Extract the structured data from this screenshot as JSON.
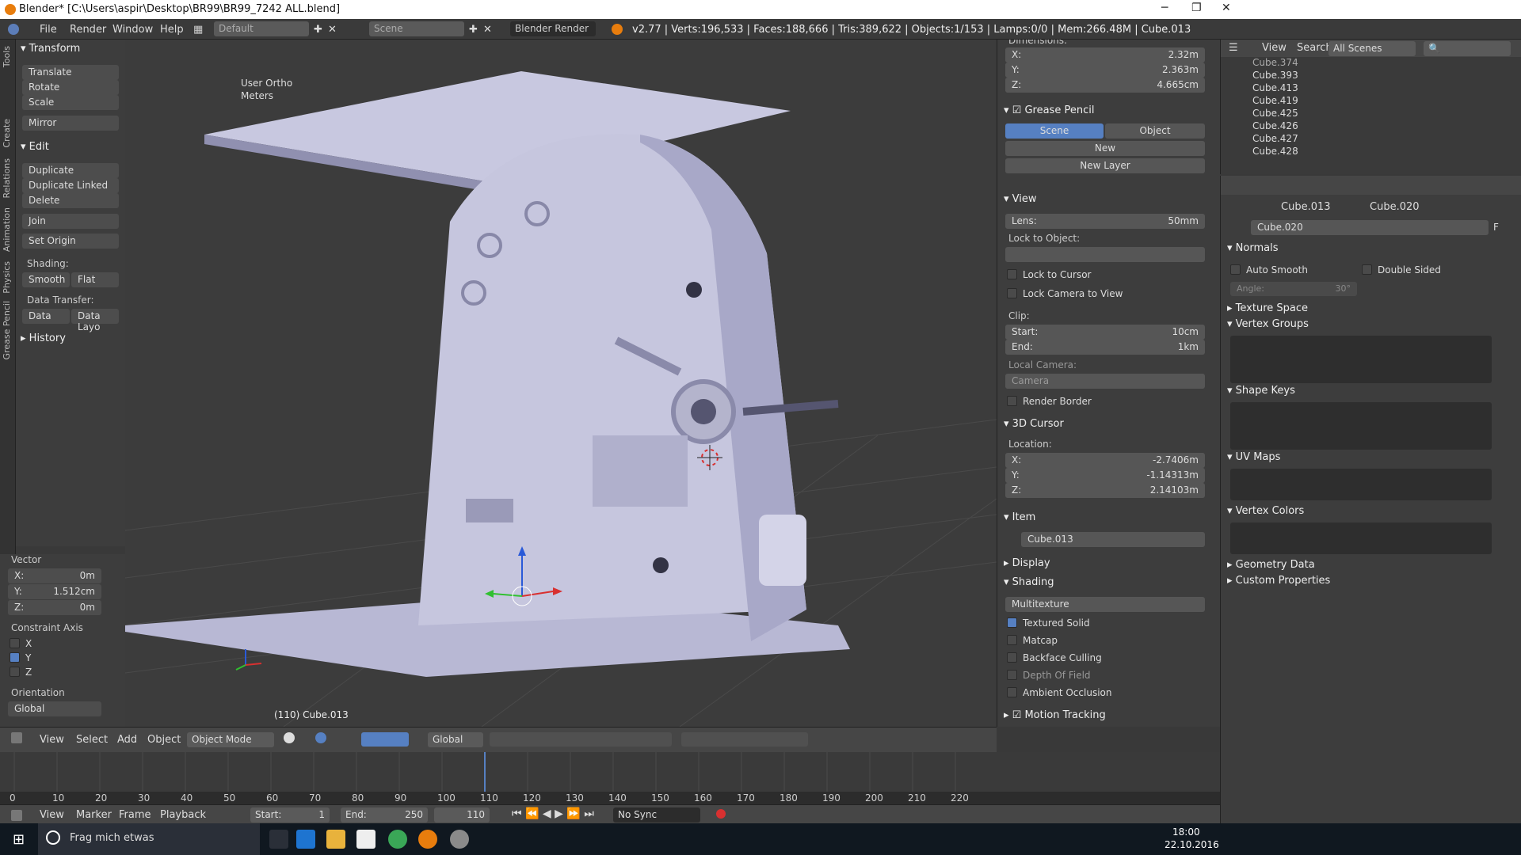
{
  "titlebar": {
    "title": "Blender* [C:\\Users\\aspir\\Desktop\\BR99\\BR99_7242 ALL.blend]",
    "minimize": "─",
    "maximize": "❐",
    "close": "✕"
  },
  "info": {
    "menus": [
      "File",
      "Render",
      "Window",
      "Help"
    ],
    "layout": "Default",
    "scene": "Scene",
    "engine": "Blender Render",
    "stats": "v2.77 | Verts:196,533 | Faces:188,666 | Tris:389,622 | Objects:1/153 | Lamps:0/0 | Mem:266.48M | Cube.013"
  },
  "lefttabs": [
    "Tools",
    "Create",
    "Relations",
    "Animation",
    "Physics",
    "Grease Pencil"
  ],
  "toolshelf": {
    "transform_header": "Transform",
    "transform": [
      "Translate",
      "Rotate",
      "Scale",
      "Mirror"
    ],
    "edit_header": "Edit",
    "edit": [
      "Duplicate",
      "Duplicate Linked",
      "Delete",
      "Join",
      "Set Origin"
    ],
    "shading_label": "Shading:",
    "smooth": "Smooth",
    "flat": "Flat",
    "data_transfer_label": "Data Transfer:",
    "data": "Data",
    "data_layo": "Data Layo",
    "history_header": "History"
  },
  "redo": {
    "vector_label": "Vector",
    "x": "X:",
    "x_val": "0m",
    "y": "Y:",
    "y_val": "1.512cm",
    "z": "Z:",
    "z_val": "0m",
    "constraint_label": "Constraint Axis",
    "cx": "X",
    "cy": "Y",
    "cz": "Z",
    "orientation_label": "Orientation",
    "orientation": "Global"
  },
  "viewport": {
    "view_name": "User Ortho",
    "units": "Meters",
    "object_info": "(110) Cube.013"
  },
  "vp_header": {
    "view": "View",
    "select": "Select",
    "add": "Add",
    "object": "Object",
    "mode": "Object Mode",
    "orientation": "Global"
  },
  "timeline": {
    "ticks": [
      "0",
      "10",
      "20",
      "30",
      "40",
      "50",
      "60",
      "70",
      "80",
      "90",
      "100",
      "110",
      "120",
      "130",
      "140",
      "150",
      "160",
      "170",
      "180",
      "190",
      "200",
      "210",
      "220"
    ],
    "current_frame": 110,
    "view": "View",
    "marker": "Marker",
    "frame": "Frame",
    "playback": "Playback",
    "start_label": "Start:",
    "start": "1",
    "end_label": "End:",
    "end": "250",
    "current": "110",
    "sync": "No Sync"
  },
  "npanel": {
    "dimensions_label": "Dimensions:",
    "dim_x_label": "X:",
    "dim_x": "2.32m",
    "dim_y_label": "Y:",
    "dim_y": "2.363m",
    "dim_z_label": "Z:",
    "dim_z": "4.665cm",
    "grease_pencil": "Grease Pencil",
    "gp_scene": "Scene",
    "gp_object": "Object",
    "gp_new": "New",
    "gp_new_layer": "New Layer",
    "view_header": "View",
    "lens_label": "Lens:",
    "lens": "50mm",
    "lock_to_object": "Lock to Object:",
    "lock_to_cursor": "Lock to Cursor",
    "lock_camera": "Lock Camera to View",
    "clip_label": "Clip:",
    "clip_start_label": "Start:",
    "clip_start": "10cm",
    "clip_end_label": "End:",
    "clip_end": "1km",
    "local_camera_label": "Local Camera:",
    "camera": "Camera",
    "render_border": "Render Border",
    "cursor_header": "3D Cursor",
    "location_label": "Location:",
    "cur_x_label": "X:",
    "cur_x": "-2.7406m",
    "cur_y_label": "Y:",
    "cur_y": "-1.14313m",
    "cur_z_label": "Z:",
    "cur_z": "2.14103m",
    "item_header": "Item",
    "item_name": "Cube.013",
    "display_header": "Display",
    "shading_header": "Shading",
    "shading_mode": "Multitexture",
    "textured_solid": "Textured Solid",
    "matcap": "Matcap",
    "backface": "Backface Culling",
    "dof": "Depth Of Field",
    "ao": "Ambient Occlusion",
    "motion_tracking": "Motion Tracking"
  },
  "outliner": {
    "view": "View",
    "search": "Search",
    "scenes": "All Scenes",
    "items": [
      "Cube.374",
      "Cube.393",
      "Cube.413",
      "Cube.419",
      "Cube.425",
      "Cube.426",
      "Cube.427",
      "Cube.428"
    ]
  },
  "props": {
    "object": "Cube.013",
    "mesh": "Cube.020",
    "mesh_field": "Cube.020",
    "f": "F",
    "normals": "Normals",
    "auto_smooth": "Auto Smooth",
    "double_sided": "Double Sided",
    "angle_label": "Angle:",
    "angle": "30°",
    "texture_space": "Texture Space",
    "vertex_groups": "Vertex Groups",
    "shape_keys": "Shape Keys",
    "uv_maps": "UV Maps",
    "vertex_colors": "Vertex Colors",
    "geometry_data": "Geometry Data",
    "custom_properties": "Custom Properties"
  },
  "taskbar": {
    "search": "Frag mich etwas",
    "time": "18:00",
    "date": "22.10.2016"
  }
}
